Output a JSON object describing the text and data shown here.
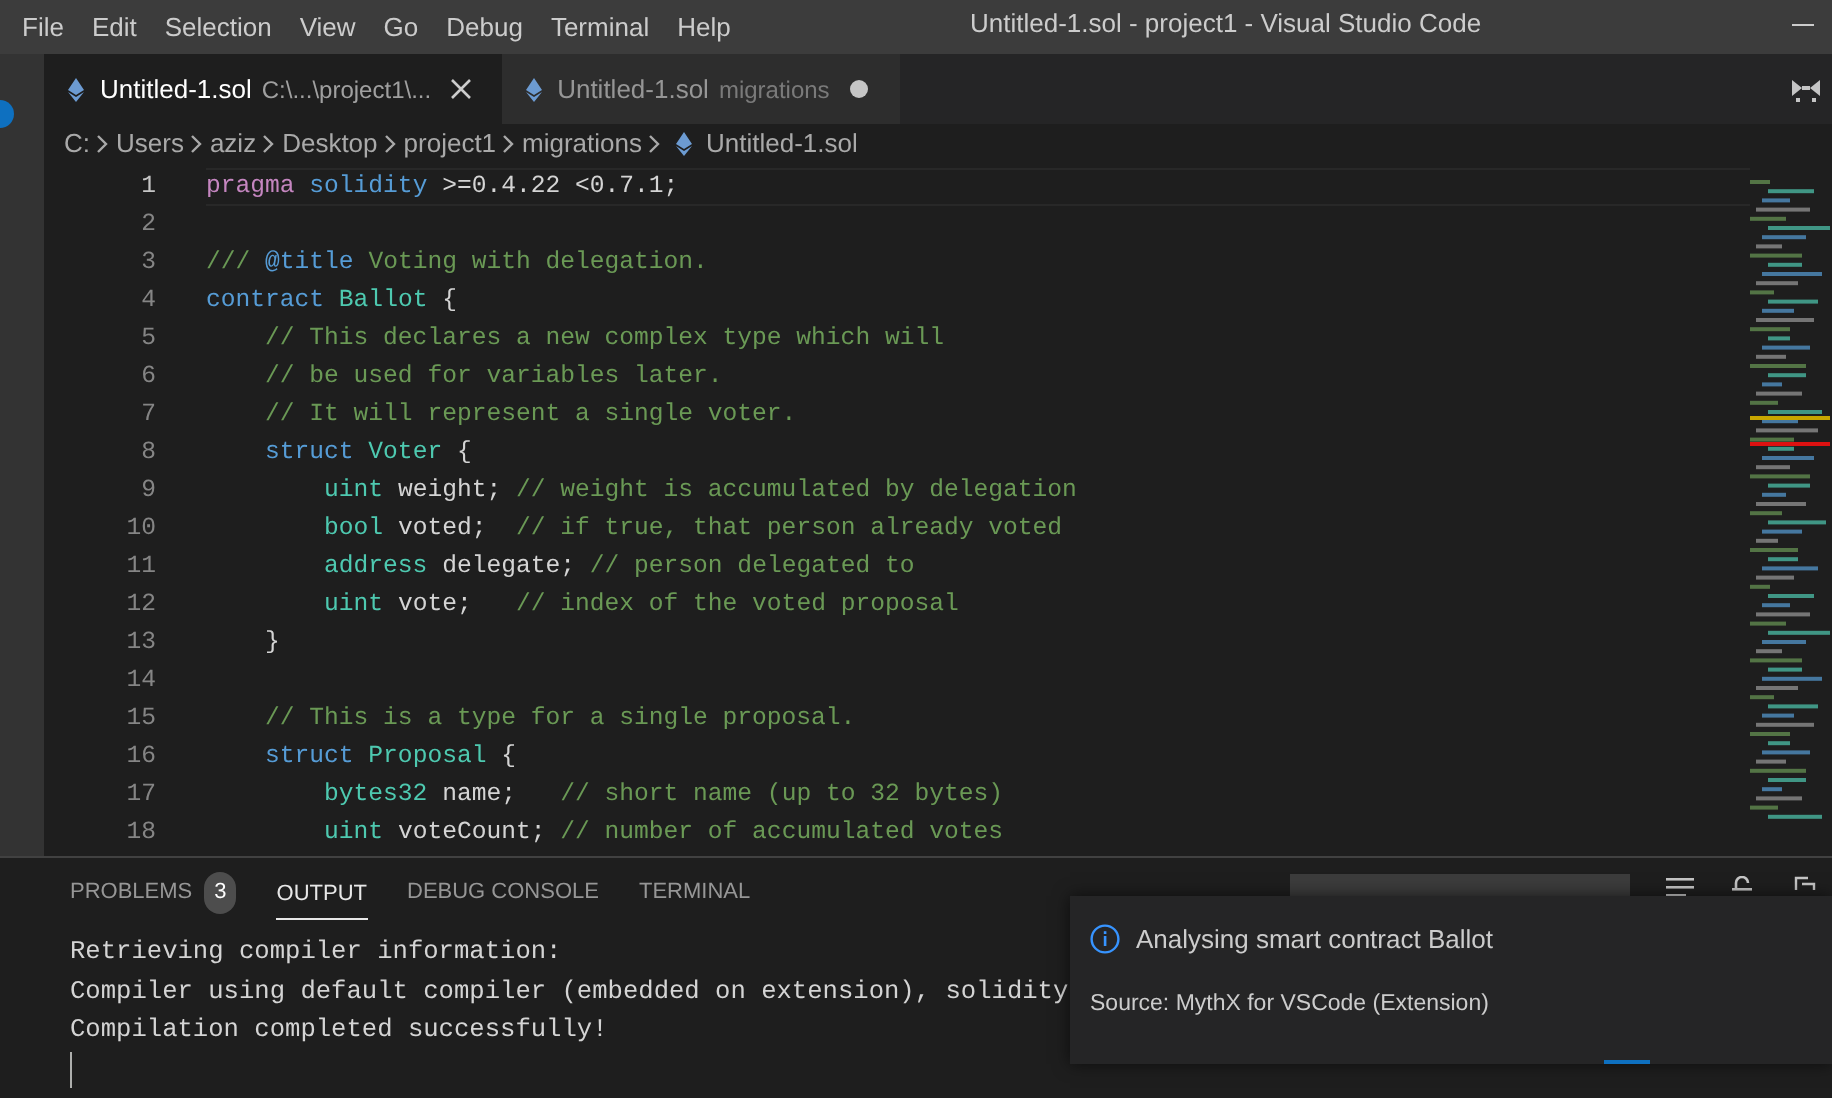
{
  "window": {
    "title": "Untitled-1.sol - project1 - Visual Studio Code"
  },
  "menu": [
    "File",
    "Edit",
    "Selection",
    "View",
    "Go",
    "Debug",
    "Terminal",
    "Help"
  ],
  "tabs": [
    {
      "label": "Untitled-1.sol",
      "description": "C:\\...\\project1\\...",
      "selected": true,
      "dirty": false
    },
    {
      "label": "Untitled-1.sol",
      "description": "migrations",
      "selected": false,
      "dirty": true
    }
  ],
  "breadcrumbs": [
    "C:",
    "Users",
    "aziz",
    "Desktop",
    "project1",
    "migrations",
    "Untitled-1.sol"
  ],
  "editor": {
    "lines": [
      {
        "number": "1",
        "current": true,
        "tokens": [
          {
            "kind": "pragma",
            "t": "pragma"
          },
          {
            "kind": "keyword",
            "t": " solidity"
          },
          {
            "kind": "plain",
            "t": " >=0.4.22 <0.7.1;"
          }
        ]
      },
      {
        "number": "2",
        "current": false
      },
      {
        "number": "3",
        "current": false,
        "tokens": [
          {
            "kind": "comment",
            "t": "/// "
          },
          {
            "kind": "keyword",
            "t": "@title"
          },
          {
            "kind": "comment",
            "t": " Voting with delegation."
          }
        ]
      },
      {
        "number": "4",
        "current": false,
        "tokens": [
          {
            "kind": "keyword",
            "t": "contract"
          },
          {
            "kind": "type",
            "t": " Ballot"
          },
          {
            "kind": "plain",
            "t": " {"
          }
        ]
      },
      {
        "number": "5",
        "current": false,
        "tokens": [
          {
            "kind": "comment",
            "t": "    // This declares a new complex type which will"
          }
        ]
      },
      {
        "number": "6",
        "current": false,
        "tokens": [
          {
            "kind": "comment",
            "t": "    // be used for variables later."
          }
        ]
      },
      {
        "number": "7",
        "current": false,
        "tokens": [
          {
            "kind": "comment",
            "t": "    // It will represent a single voter."
          }
        ]
      },
      {
        "number": "8",
        "current": false,
        "tokens": [
          {
            "kind": "keyword",
            "t": "    struct"
          },
          {
            "kind": "type",
            "t": " Voter"
          },
          {
            "kind": "plain",
            "t": " {"
          }
        ]
      },
      {
        "number": "9",
        "current": false,
        "tokens": [
          {
            "kind": "type",
            "t": "        uint"
          },
          {
            "kind": "plain",
            "t": " weight; "
          },
          {
            "kind": "comment",
            "t": "// weight is accumulated by delegation"
          }
        ]
      },
      {
        "number": "10",
        "current": false,
        "tokens": [
          {
            "kind": "type",
            "t": "        bool"
          },
          {
            "kind": "plain",
            "t": " voted;  "
          },
          {
            "kind": "comment",
            "t": "// if true, that person already voted"
          }
        ]
      },
      {
        "number": "11",
        "current": false,
        "tokens": [
          {
            "kind": "type",
            "t": "        address"
          },
          {
            "kind": "plain",
            "t": " delegate; "
          },
          {
            "kind": "comment",
            "t": "// person delegated to"
          }
        ]
      },
      {
        "number": "12",
        "current": false,
        "tokens": [
          {
            "kind": "type",
            "t": "        uint"
          },
          {
            "kind": "plain",
            "t": " vote;   "
          },
          {
            "kind": "comment",
            "t": "// index of the voted proposal"
          }
        ]
      },
      {
        "number": "13",
        "current": false,
        "tokens": [
          {
            "kind": "plain",
            "t": "    }"
          }
        ]
      },
      {
        "number": "14",
        "current": false
      },
      {
        "number": "15",
        "current": false,
        "tokens": [
          {
            "kind": "comment",
            "t": "    // This is a type for a single proposal."
          }
        ]
      },
      {
        "number": "16",
        "current": false,
        "tokens": [
          {
            "kind": "keyword",
            "t": "    struct"
          },
          {
            "kind": "type",
            "t": " Proposal"
          },
          {
            "kind": "plain",
            "t": " {"
          }
        ]
      },
      {
        "number": "17",
        "current": false,
        "tokens": [
          {
            "kind": "type",
            "t": "        bytes32"
          },
          {
            "kind": "plain",
            "t": " name;   "
          },
          {
            "kind": "comment",
            "t": "// short name (up to 32 bytes)"
          }
        ]
      },
      {
        "number": "18",
        "current": false,
        "tokens": [
          {
            "kind": "type",
            "t": "        uint"
          },
          {
            "kind": "plain",
            "t": " voteCount; "
          },
          {
            "kind": "comment",
            "t": "// number of accumulated votes"
          }
        ]
      }
    ]
  },
  "panel": {
    "tabs": [
      {
        "label": "PROBLEMS",
        "badge": "3",
        "selected": false
      },
      {
        "label": "OUTPUT",
        "selected": true
      },
      {
        "label": "DEBUG CONSOLE",
        "selected": false
      },
      {
        "label": "TERMINAL",
        "selected": false
      }
    ],
    "output": [
      "Retrieving compiler information:",
      "Compiler using default compiler (embedded on extension), solidity",
      "Compilation completed successfully!"
    ]
  },
  "notification": {
    "message": "Analysing smart contract Ballot",
    "source": "Source: MythX for VSCode (Extension)"
  }
}
